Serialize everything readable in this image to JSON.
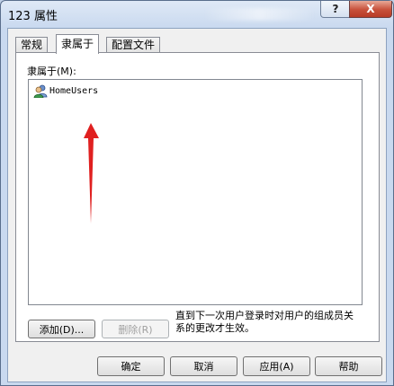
{
  "window": {
    "title": "123 属性",
    "help_label": "?",
    "close_label": "X"
  },
  "tabs": [
    {
      "label": "常规"
    },
    {
      "label": "隶属于",
      "active": true
    },
    {
      "label": "配置文件"
    }
  ],
  "member_of": {
    "label": "隶属于(M):",
    "items": [
      {
        "name": "HomeUsers",
        "icon": "user-group-icon"
      }
    ]
  },
  "buttons": {
    "add": "添加(D)...",
    "remove": "删除(R)"
  },
  "note": "直到下一次用户登录时对用户的组成员关系的更改才生效。",
  "footer": {
    "ok": "确定",
    "cancel": "取消",
    "apply": "应用(A)",
    "help": "帮助"
  },
  "annotation": {
    "arrow_color": "#e02020"
  }
}
